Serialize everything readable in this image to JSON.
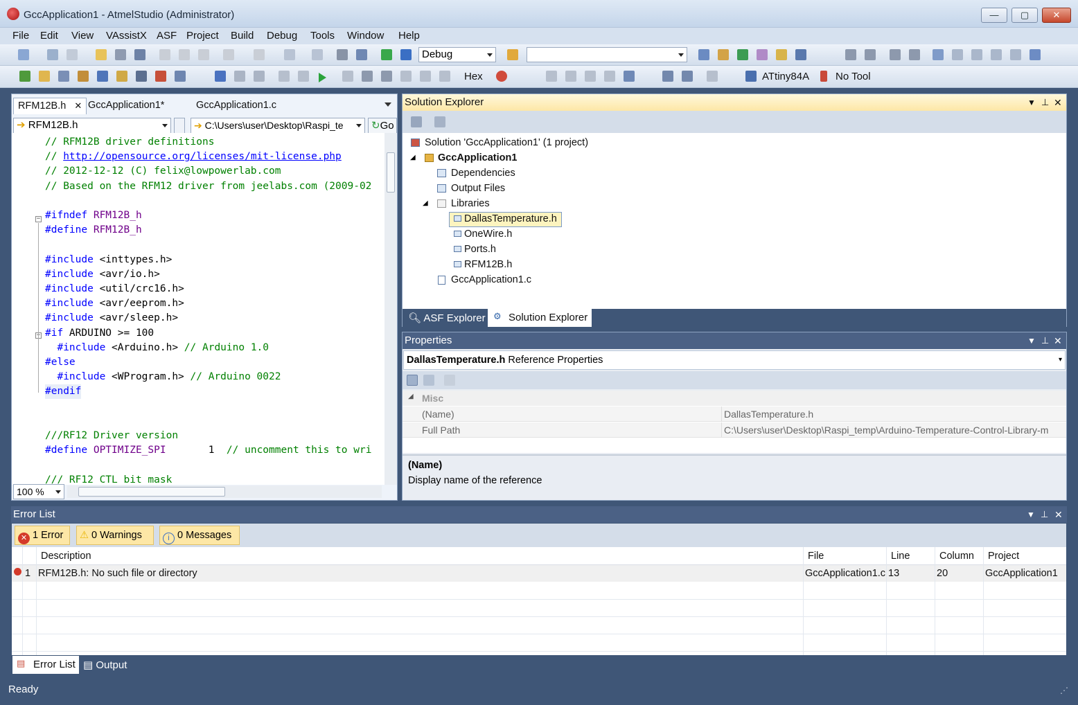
{
  "window": {
    "title": "GccApplication1 - AtmelStudio (Administrator)",
    "min": "—",
    "max": "▢",
    "close": "✕"
  },
  "menu": [
    "File",
    "Edit",
    "View",
    "VAssistX",
    "ASF",
    "Project",
    "Build",
    "Debug",
    "Tools",
    "Window",
    "Help"
  ],
  "toolbar": {
    "config": "Debug",
    "search_value": "",
    "hex": "Hex",
    "device": "ATtiny84A",
    "tool": "No Tool"
  },
  "editor": {
    "tabs": [
      "RFM12B.h",
      "GccApplication1*",
      "GccApplication1.c"
    ],
    "tab_close": "✕",
    "file_combo": "RFM12B.h",
    "path_combo": "C:\\Users\\user\\Desktop\\Raspi_te",
    "go": "Go",
    "zoom": "100 %"
  },
  "code_lines": [
    [
      {
        "t": "// RFM12B driver definitions",
        "c": "cm"
      }
    ],
    [
      {
        "t": "// ",
        "c": "cm"
      },
      {
        "t": "http://opensource.org/licenses/mit-license.php",
        "c": "lk"
      }
    ],
    [
      {
        "t": "// 2012-12-12 (C) felix@lowpowerlab.com",
        "c": "cm"
      }
    ],
    [
      {
        "t": "// Based on the RFM12 driver from jeelabs.com (2009-02",
        "c": "cm"
      }
    ],
    [],
    [
      {
        "t": "#ifndef ",
        "c": "kw"
      },
      {
        "t": "RFM12B_h",
        "c": "mc"
      }
    ],
    [
      {
        "t": "#define ",
        "c": "kw"
      },
      {
        "t": "RFM12B_h",
        "c": "mc"
      }
    ],
    [],
    [
      {
        "t": "#include ",
        "c": "kw"
      },
      {
        "t": "<inttypes.h>",
        "c": ""
      }
    ],
    [
      {
        "t": "#include ",
        "c": "kw"
      },
      {
        "t": "<avr/io.h>",
        "c": ""
      }
    ],
    [
      {
        "t": "#include ",
        "c": "kw"
      },
      {
        "t": "<util/crc16.h>",
        "c": ""
      }
    ],
    [
      {
        "t": "#include ",
        "c": "kw"
      },
      {
        "t": "<avr/eeprom.h>",
        "c": ""
      }
    ],
    [
      {
        "t": "#include ",
        "c": "kw"
      },
      {
        "t": "<avr/sleep.h>",
        "c": ""
      }
    ],
    [
      {
        "t": "#if ",
        "c": "kw"
      },
      {
        "t": "ARDUINO >= 100",
        "c": ""
      }
    ],
    [
      {
        "t": "  #include ",
        "c": "kw"
      },
      {
        "t": "<Arduino.h> ",
        "c": ""
      },
      {
        "t": "// Arduino 1.0",
        "c": "cm"
      }
    ],
    [
      {
        "t": "#else",
        "c": "kw"
      }
    ],
    [
      {
        "t": "  #include ",
        "c": "kw"
      },
      {
        "t": "<WProgram.h> ",
        "c": ""
      },
      {
        "t": "// Arduino 0022",
        "c": "cm"
      }
    ],
    [
      {
        "t": "#endif",
        "c": "kw"
      }
    ],
    [],
    [],
    [
      {
        "t": "///RF12 Driver version",
        "c": "cm"
      }
    ],
    [
      {
        "t": "#define ",
        "c": "kw"
      },
      {
        "t": "OPTIMIZE_SPI",
        "c": "mc"
      },
      {
        "t": "       1  ",
        "c": ""
      },
      {
        "t": "// uncomment this to wri",
        "c": "cm"
      }
    ],
    [],
    [
      {
        "t": "/// RF12 CTL bit mask",
        "c": "cm"
      }
    ]
  ],
  "solution_explorer": {
    "title": "Solution Explorer",
    "items": [
      {
        "label": "Solution 'GccApplication1' (1 project)",
        "bold": false
      },
      {
        "label": "GccApplication1",
        "bold": true
      },
      {
        "label": "Dependencies",
        "bold": false
      },
      {
        "label": "Output Files",
        "bold": false
      },
      {
        "label": "Libraries",
        "bold": false
      },
      {
        "label": "DallasTemperature.h",
        "bold": false
      },
      {
        "label": "OneWire.h",
        "bold": false
      },
      {
        "label": "Ports.h",
        "bold": false
      },
      {
        "label": "RFM12B.h",
        "bold": false
      },
      {
        "label": "GccApplication1.c",
        "bold": false
      }
    ],
    "tabs": [
      "ASF Explorer",
      "Solution Explorer"
    ]
  },
  "properties": {
    "title": "Properties",
    "object": "DallasTemperature.h",
    "object_type": "Reference Properties",
    "category": "Misc",
    "rows": [
      {
        "name": "(Name)",
        "value": "DallasTemperature.h"
      },
      {
        "name": "Full Path",
        "value": "C:\\Users\\user\\Desktop\\Raspi_temp\\Arduino-Temperature-Control-Library-m"
      }
    ],
    "desc_title": "(Name)",
    "desc_text": "Display name of the reference"
  },
  "error_list": {
    "title": "Error List",
    "filters": [
      "1 Error",
      "0 Warnings",
      "0 Messages"
    ],
    "columns": [
      "Description",
      "File",
      "Line",
      "Column",
      "Project"
    ],
    "rows": [
      {
        "num": "1",
        "description": "RFM12B.h: No such file or directory",
        "file": "GccApplication1.c",
        "line": "13",
        "column": "20",
        "project": "GccApplication1"
      }
    ],
    "tabs": [
      "Error List",
      "Output"
    ]
  },
  "status": "Ready",
  "colors": {
    "accent": "#3f5677",
    "selection": "#fdf4bf",
    "error": "#d43a2a"
  }
}
